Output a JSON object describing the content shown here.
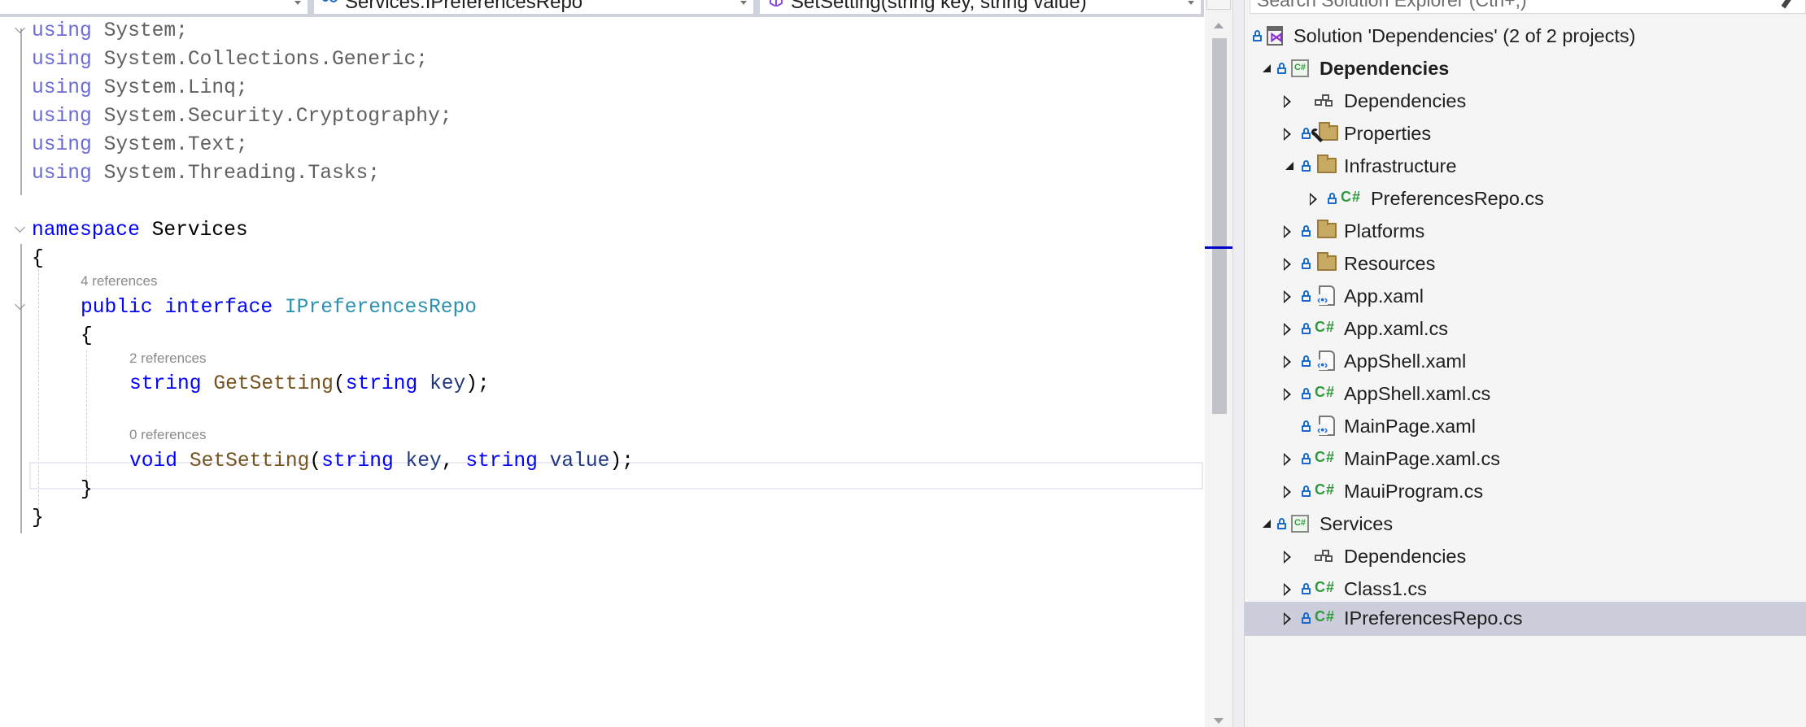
{
  "nav": {
    "project_dropdown": "",
    "type_dropdown": "Services.IPreferencesRepo",
    "member_dropdown": "SetSetting(string key, string value)"
  },
  "editor": {
    "usings": [
      {
        "kw": "using",
        "ns": "System;"
      },
      {
        "kw": "using",
        "ns": "System.Collections.Generic;"
      },
      {
        "kw": "using",
        "ns": "System.Linq;"
      },
      {
        "kw": "using",
        "ns": "System.Security.Cryptography;"
      },
      {
        "kw": "using",
        "ns": "System.Text;"
      },
      {
        "kw": "using",
        "ns": "System.Threading.Tasks;"
      }
    ],
    "namespace_kw": "namespace",
    "namespace_name": "Services",
    "open_brace": "{",
    "close_brace": "}",
    "interface": {
      "references": "4 references",
      "modifier": "public",
      "kw": "interface",
      "name": "IPreferencesRepo"
    },
    "methods": [
      {
        "references": "2 references",
        "return_type": "string",
        "name": "GetSetting",
        "open": "(",
        "params": [
          {
            "type": "string",
            "name": "key"
          }
        ],
        "close": ");"
      },
      {
        "references": "0 references",
        "return_type": "void",
        "name": "SetSetting",
        "open": "(",
        "params": [
          {
            "type": "string",
            "name": "key"
          },
          {
            "type": "string",
            "name": "value"
          }
        ],
        "close": ");"
      }
    ],
    "comma": ", "
  },
  "solution_explorer": {
    "search_placeholder": "Search Solution Explorer (Ctrl+;)",
    "items": [
      {
        "label": "Solution 'Dependencies' (2 of 2 projects)",
        "icon": "solution-icon"
      },
      {
        "label": "Dependencies",
        "icon": "csharp-project-icon",
        "expanded": true,
        "bold": true
      },
      {
        "label": "Dependencies",
        "icon": "dependencies-icon",
        "expanded": false
      },
      {
        "label": "Properties",
        "icon": "properties-folder-icon",
        "expanded": false
      },
      {
        "label": "Infrastructure",
        "icon": "folder-icon",
        "expanded": true
      },
      {
        "label": "PreferencesRepo.cs",
        "icon": "csharp-file-icon",
        "expanded": false
      },
      {
        "label": "Platforms",
        "icon": "folder-icon",
        "expanded": false
      },
      {
        "label": "Resources",
        "icon": "folder-icon",
        "expanded": false
      },
      {
        "label": "App.xaml",
        "icon": "xaml-file-icon",
        "expanded": false
      },
      {
        "label": "App.xaml.cs",
        "icon": "csharp-file-icon",
        "expanded": false
      },
      {
        "label": "AppShell.xaml",
        "icon": "xaml-file-icon",
        "expanded": false
      },
      {
        "label": "AppShell.xaml.cs",
        "icon": "csharp-file-icon",
        "expanded": false
      },
      {
        "label": "MainPage.xaml",
        "icon": "xaml-file-icon"
      },
      {
        "label": "MainPage.xaml.cs",
        "icon": "csharp-file-icon",
        "expanded": false
      },
      {
        "label": "MauiProgram.cs",
        "icon": "csharp-file-icon",
        "expanded": false
      },
      {
        "label": "Services",
        "icon": "csharp-project-icon",
        "expanded": true
      },
      {
        "label": "Dependencies",
        "icon": "dependencies-icon",
        "expanded": false
      },
      {
        "label": "Class1.cs",
        "icon": "csharp-file-icon",
        "expanded": false
      },
      {
        "label": "IPreferencesRepo.cs",
        "icon": "csharp-file-icon",
        "expanded": false,
        "selected": true
      }
    ],
    "cs_glyph": "C#",
    "proj_glyph": "C#"
  },
  "colors": {
    "keyword": "#0000ff",
    "type": "#2b91af",
    "method": "#74531f",
    "parameter": "#1f377f",
    "selection": "#cccedb",
    "scroll_marker": "#0000cc"
  }
}
